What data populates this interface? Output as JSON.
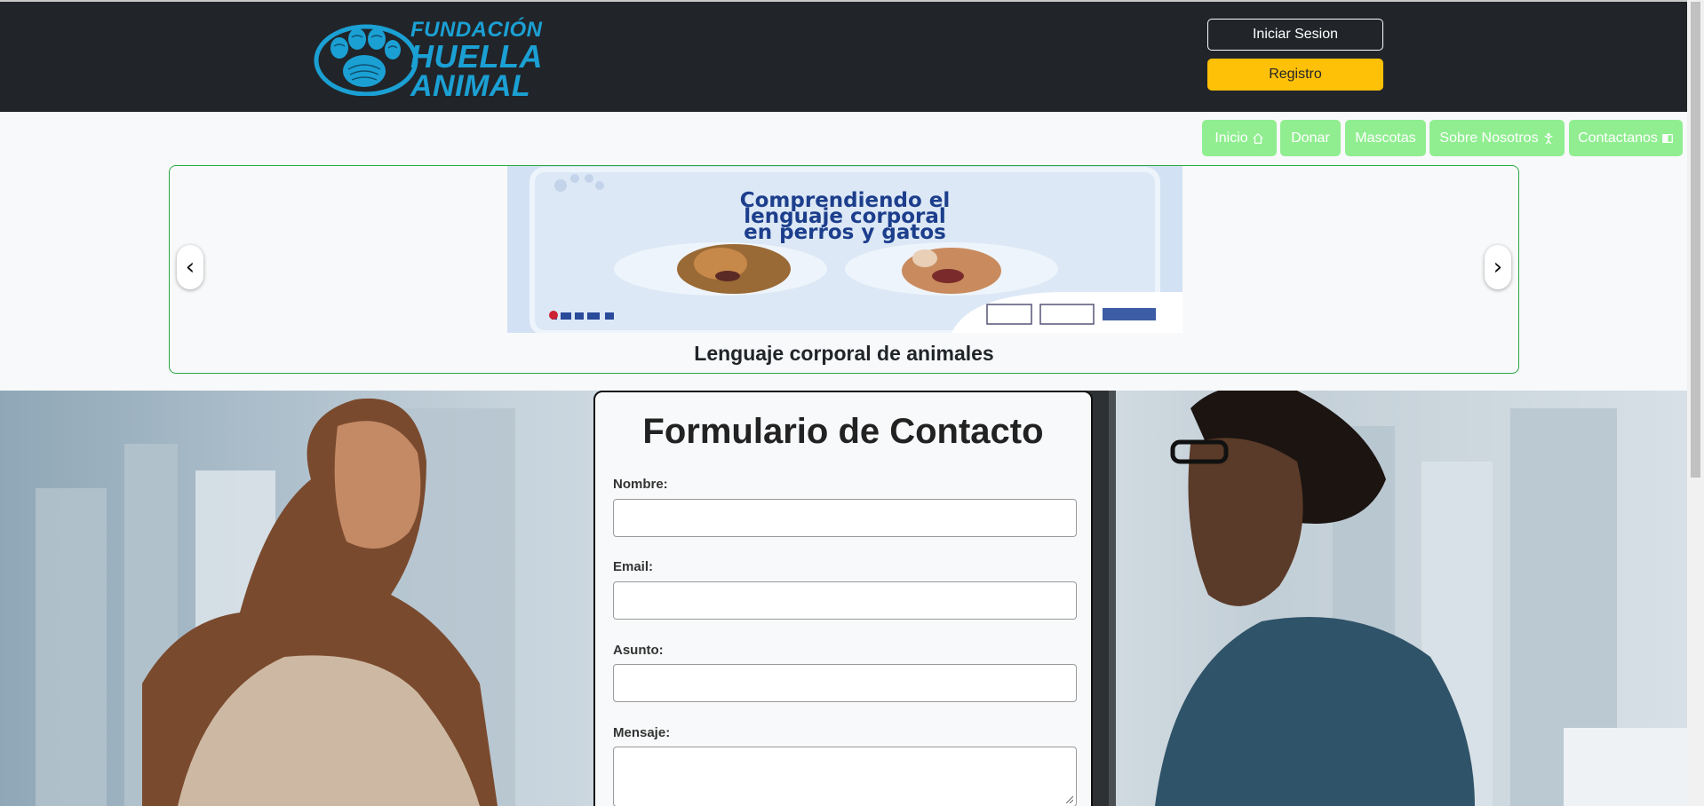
{
  "header": {
    "logo": {
      "line1": "FUNDACIÓN",
      "line2": "HUELLA",
      "line3": "ANIMAL"
    },
    "login_label": "Iniciar Sesion",
    "register_label": "Registro"
  },
  "nav": {
    "items": [
      {
        "label": "Inicio",
        "icon": "house-icon"
      },
      {
        "label": "Donar",
        "icon": ""
      },
      {
        "label": "Mascotas",
        "icon": ""
      },
      {
        "label": "Sobre Nosotros",
        "icon": "person-icon"
      },
      {
        "label": "Contactanos",
        "icon": "book-icon"
      }
    ]
  },
  "carousel": {
    "prev": "‹",
    "next": "›",
    "slide": {
      "image_text": [
        "Comprendiendo el",
        "lenguaje corporal",
        "en perros y gatos"
      ],
      "caption": "Lenguaje corporal de animales"
    }
  },
  "form": {
    "title": "Formulario de Contacto",
    "fields": {
      "name_label": "Nombre:",
      "email_label": "Email:",
      "subject_label": "Asunto:",
      "message_label": "Mensaje:"
    }
  },
  "colors": {
    "header_bg": "#212529",
    "nav_green": "#90ee90",
    "register_yellow": "#ffc107",
    "logo_blue": "#1ba0d4",
    "carousel_border": "#28a745"
  }
}
